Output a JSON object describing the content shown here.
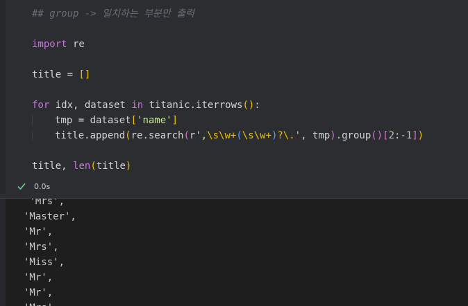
{
  "code_lines": [
    {
      "tokens": [
        {
          "cls": "t-comment",
          "text": "## group -> 일치하는 부분만 출력"
        }
      ]
    },
    {
      "tokens": []
    },
    {
      "tokens": [
        {
          "cls": "t-kw",
          "text": "import"
        },
        {
          "cls": "t-plain",
          "text": " re"
        }
      ]
    },
    {
      "tokens": []
    },
    {
      "tokens": [
        {
          "cls": "t-plain",
          "text": "title = "
        },
        {
          "cls": "t-brk",
          "text": "[]"
        }
      ]
    },
    {
      "tokens": []
    },
    {
      "tokens": [
        {
          "cls": "t-kw",
          "text": "for"
        },
        {
          "cls": "t-plain",
          "text": " idx, dataset "
        },
        {
          "cls": "t-kw",
          "text": "in"
        },
        {
          "cls": "t-plain",
          "text": " titanic.iterrows"
        },
        {
          "cls": "t-brk",
          "text": "()"
        },
        {
          "cls": "t-plain",
          "text": ":"
        }
      ]
    },
    {
      "indent": true,
      "tokens": [
        {
          "cls": "t-plain",
          "text": "tmp = dataset"
        },
        {
          "cls": "t-brk",
          "text": "["
        },
        {
          "cls": "t-str",
          "text": "'name'"
        },
        {
          "cls": "t-brk",
          "text": "]"
        }
      ]
    },
    {
      "indent": true,
      "tokens": [
        {
          "cls": "t-plain",
          "text": "title.append"
        },
        {
          "cls": "t-brk",
          "text": "("
        },
        {
          "cls": "t-plain",
          "text": "re.search"
        },
        {
          "cls": "t-brk2",
          "text": "("
        },
        {
          "cls": "t-plain",
          "text": "r"
        },
        {
          "cls": "t-str",
          "text": "',"
        },
        {
          "cls": "t-esc",
          "text": "\\s\\w+"
        },
        {
          "cls": "t-brk3",
          "text": "("
        },
        {
          "cls": "t-esc",
          "text": "\\s\\w+"
        },
        {
          "cls": "t-brk3",
          "text": ")"
        },
        {
          "cls": "t-esc",
          "text": "?\\."
        },
        {
          "cls": "t-str",
          "text": "'"
        },
        {
          "cls": "t-plain",
          "text": ", tmp"
        },
        {
          "cls": "t-brk2",
          "text": ")"
        },
        {
          "cls": "t-plain",
          "text": ".group"
        },
        {
          "cls": "t-brk2",
          "text": "()"
        },
        {
          "cls": "t-brk2",
          "text": "["
        },
        {
          "cls": "t-num",
          "text": "2"
        },
        {
          "cls": "t-plain",
          "text": ":"
        },
        {
          "cls": "t-num",
          "text": "-1"
        },
        {
          "cls": "t-brk2",
          "text": "]"
        },
        {
          "cls": "t-brk",
          "text": ")"
        }
      ]
    },
    {
      "tokens": []
    },
    {
      "tokens": [
        {
          "cls": "t-plain",
          "text": "title, "
        },
        {
          "cls": "t-builtin",
          "text": "len"
        },
        {
          "cls": "t-brk",
          "text": "("
        },
        {
          "cls": "t-plain",
          "text": "title"
        },
        {
          "cls": "t-brk",
          "text": ")"
        }
      ]
    }
  ],
  "status": {
    "icon": "check-icon",
    "icon_color": "#73c991",
    "exec_time": "0.0s"
  },
  "output_lines": [
    " 'Mrs',",
    "'Master',",
    "'Mr',",
    "'Mrs',",
    "'Miss',",
    "'Mr',",
    "'Mr',",
    "'Mrs',"
  ]
}
